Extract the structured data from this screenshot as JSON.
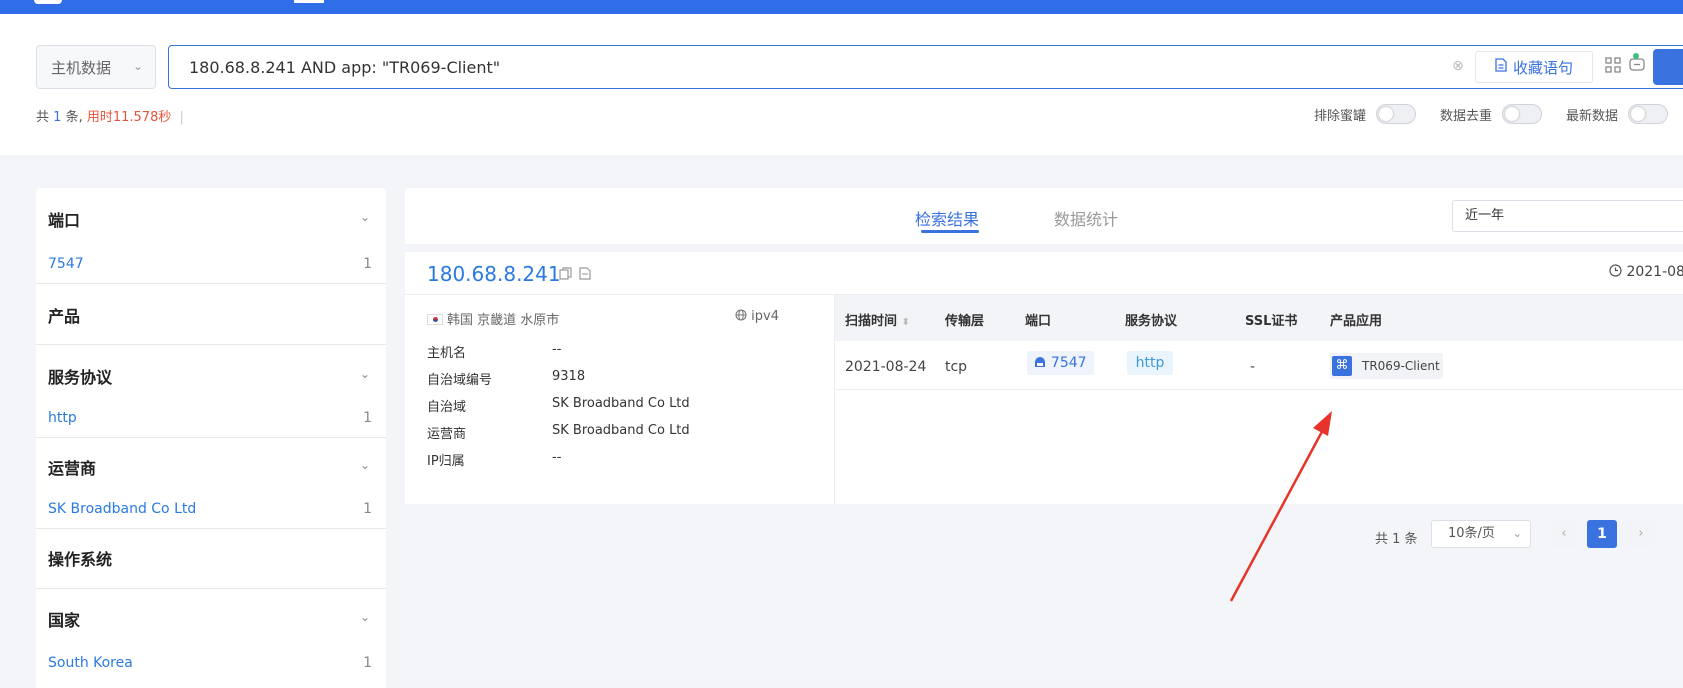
{
  "search": {
    "type_label": "主机数据",
    "query": "180.68.8.241 AND app: \"TR069-Client\"",
    "favorite_label": "收藏语句"
  },
  "summary": {
    "prefix": "共",
    "count": "1",
    "suffix": "条,",
    "time": "用时11.578秒"
  },
  "toggles": [
    {
      "label": "排除蜜罐",
      "on": false
    },
    {
      "label": "数据去重",
      "on": false
    },
    {
      "label": "最新数据",
      "on": false
    }
  ],
  "sidebar": {
    "sections": [
      {
        "title": "端口",
        "items": [
          {
            "label": "7547",
            "count": "1"
          }
        ]
      },
      {
        "title": "产品",
        "items": []
      },
      {
        "title": "服务协议",
        "items": [
          {
            "label": "http",
            "count": "1"
          }
        ]
      },
      {
        "title": "运营商",
        "items": [
          {
            "label": "SK Broadband Co Ltd",
            "count": "1"
          }
        ]
      },
      {
        "title": "操作系统",
        "items": []
      },
      {
        "title": "国家",
        "items": [
          {
            "label": "South Korea",
            "count": "1"
          }
        ]
      }
    ]
  },
  "tabs": {
    "active": "检索结果",
    "inactive": "数据统计"
  },
  "period": "近一年",
  "result": {
    "ip": "180.68.8.241",
    "date": "2021-08",
    "location": "韩国 京畿道 水原市",
    "ip_version": "ipv4",
    "info": [
      {
        "label": "主机名",
        "value": "--"
      },
      {
        "label": "自治域编号",
        "value": "9318"
      },
      {
        "label": "自治域",
        "value": "SK Broadband Co Ltd"
      },
      {
        "label": "运营商",
        "value": "SK Broadband Co Ltd"
      },
      {
        "label": "IP归属",
        "value": "--"
      }
    ],
    "table": {
      "headers": [
        "扫描时间",
        "传输层",
        "端口",
        "服务协议",
        "SSL证书",
        "产品应用"
      ],
      "row": {
        "scan_time": "2021-08-24",
        "transport": "tcp",
        "port": "7547",
        "protocol": "http",
        "ssl": "-",
        "product": "TR069-Client"
      }
    }
  },
  "pagination": {
    "total": "共 1 条",
    "page_size": "10条/页",
    "current": "1"
  },
  "colors": {
    "accent": "#3a72e0",
    "link": "#2a7ae2",
    "time": "#e8553e",
    "annotation_arrow": "#e8332a"
  }
}
